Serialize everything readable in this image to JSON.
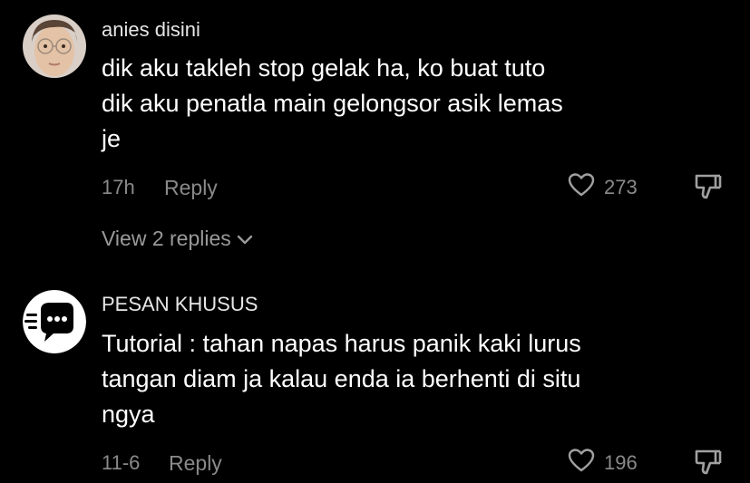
{
  "comments": [
    {
      "username": "anies disini",
      "lines": [
        "dik aku takleh stop gelak ha, ko buat tuto",
        "dik aku penatla main gelongsor asik lemas",
        "je"
      ],
      "time": "17h",
      "reply_label": "Reply",
      "likes": "273",
      "view_replies": "View 2 replies"
    },
    {
      "username": "PESAN KHUSUS",
      "lines": [
        "Tutorial : tahan napas harus panik kaki lurus",
        "tangan diam ja kalau enda ia berhenti di situ",
        "ngya"
      ],
      "time": "11-6",
      "reply_label": "Reply",
      "likes": "196"
    }
  ],
  "icons": {
    "like": "heart-outline-icon",
    "dislike": "thumbs-down-icon",
    "expand": "chevron-down-icon",
    "avatar2": "chat-bubble-logo"
  },
  "colors": {
    "background": "#000000",
    "text_primary": "#ffffff",
    "text_secondary": "#8a8a8a"
  }
}
